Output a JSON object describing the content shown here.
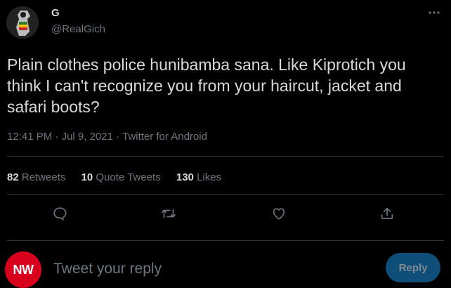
{
  "author": {
    "name": "G",
    "handle": "@RealGich"
  },
  "tweet": {
    "text": "Plain clothes police hunibamba sana. Like Kiprotich you think I can't recognize you from your haircut, jacket and safari boots?",
    "time": "12:41 PM",
    "date": "Jul 9, 2021",
    "source": "Twitter for Android",
    "separator": "·"
  },
  "stats": {
    "retweets": {
      "count": "82",
      "label": "Retweets"
    },
    "quote_tweets": {
      "count": "10",
      "label": "Quote Tweets"
    },
    "likes": {
      "count": "130",
      "label": "Likes"
    }
  },
  "actions": [
    "reply-icon",
    "retweet-icon",
    "like-icon",
    "share-icon"
  ],
  "composer": {
    "avatar_text": "NW",
    "placeholder": "Tweet your reply",
    "button_label": "Reply"
  },
  "colors": {
    "background": "#000000",
    "text": "#d9d9d9",
    "muted": "#6e767d",
    "reply_button": "#0f4e78",
    "reply_avatar": "#d9001e"
  }
}
